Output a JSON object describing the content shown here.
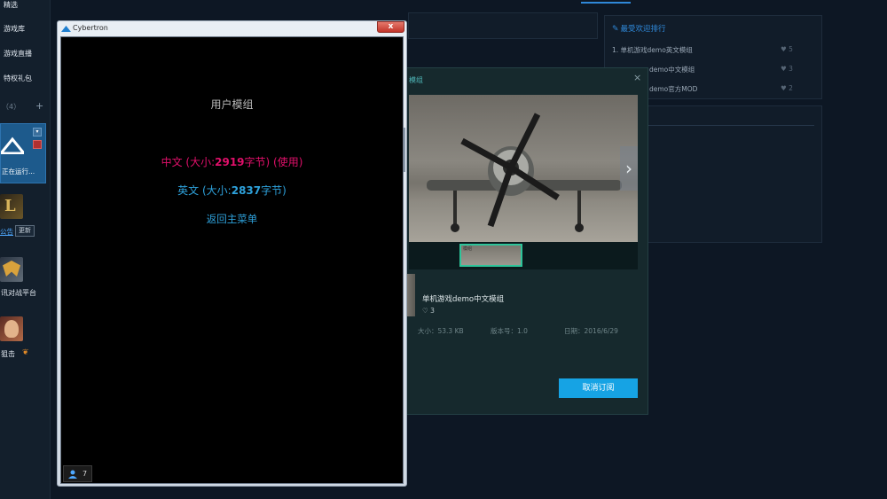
{
  "sidebar": {
    "nav": [
      "精选",
      "游戏库",
      "游戏直播",
      "特权礼包"
    ],
    "section_count": "（4）",
    "section_add": "+",
    "running_label": "正在运行...",
    "games": [
      {
        "label": "公告",
        "action": "更新"
      },
      {
        "label": "讯对战平台"
      },
      {
        "label": "狙击"
      }
    ]
  },
  "window": {
    "title": "Cybertron",
    "close": "x",
    "menu_title": "用户模组",
    "option_zh_prefix": "中文 (大小:",
    "option_zh_size": "2919",
    "option_zh_suffix": "字节) (使用)",
    "option_en_prefix": "英文 (大小:",
    "option_en_size": "2837",
    "option_en_suffix": "字节)",
    "back": "返回主菜单",
    "player_count": "7"
  },
  "ranking": {
    "title": "最受欢迎排行",
    "items": [
      {
        "label": "1. 单机游戏demo英文模组",
        "count": "5"
      },
      {
        "label": "demo中文模组",
        "count": "3"
      },
      {
        "label": "demo官方MOD",
        "count": "2"
      }
    ]
  },
  "detail": {
    "title": "模组",
    "close": "×",
    "next": "›",
    "thumb_caption": "模组",
    "name": "单机游戏demo中文模组",
    "likes": "♡ 3",
    "size": "大小：53.3 KB",
    "version": "版本号：1.0",
    "date": "日期：2016/6/29",
    "unsubscribe": "取消订阅"
  },
  "colors": {
    "accent": "#2f88d8",
    "selected_option": "#e0106a",
    "option": "#2ea2dc",
    "button": "#16a3e4"
  }
}
